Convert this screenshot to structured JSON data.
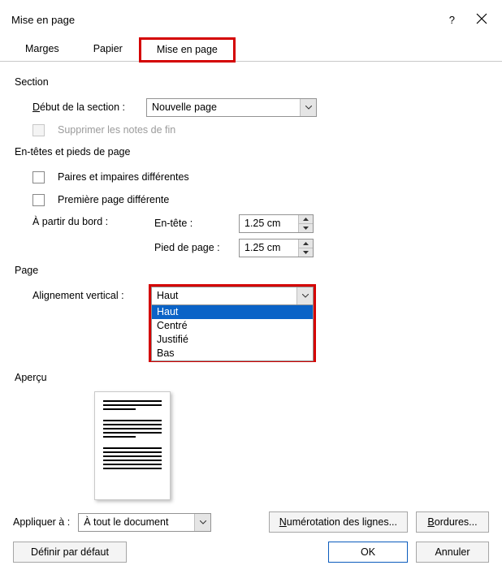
{
  "titlebar": {
    "title": "Mise en page"
  },
  "tabs": {
    "marges": "Marges",
    "papier": "Papier",
    "mise_en_page": "Mise en page"
  },
  "section": {
    "group": "Section",
    "debut_label_pre": "D",
    "debut_label_post": "ébut de la section :",
    "debut_value": "Nouvelle page",
    "supprimer": "Supprimer les notes de fin"
  },
  "headers": {
    "group": "En-têtes et pieds de page",
    "paires": "Paires et impaires différentes",
    "premiere": "Première page différente",
    "a_partir": "À partir du bord :",
    "entete_label": "En-tête :",
    "entete_value": "1.25 cm",
    "pied_label": "Pied de page :",
    "pied_value": "1.25 cm"
  },
  "page": {
    "group": "Page",
    "va_label": "Alignement vertical :",
    "va_value": "Haut",
    "options": [
      "Haut",
      "Centré",
      "Justifié",
      "Bas"
    ]
  },
  "apercu": {
    "label": "Aperçu"
  },
  "apply": {
    "label": "Appliquer à :",
    "value": "À tout le document"
  },
  "buttons": {
    "numerotation_pre": "N",
    "numerotation_post": "umérotation des lignes...",
    "bordures_pre": "B",
    "bordures_post": "ordures...",
    "defaut": "Définir par défaut",
    "ok": "OK",
    "annuler": "Annuler"
  }
}
